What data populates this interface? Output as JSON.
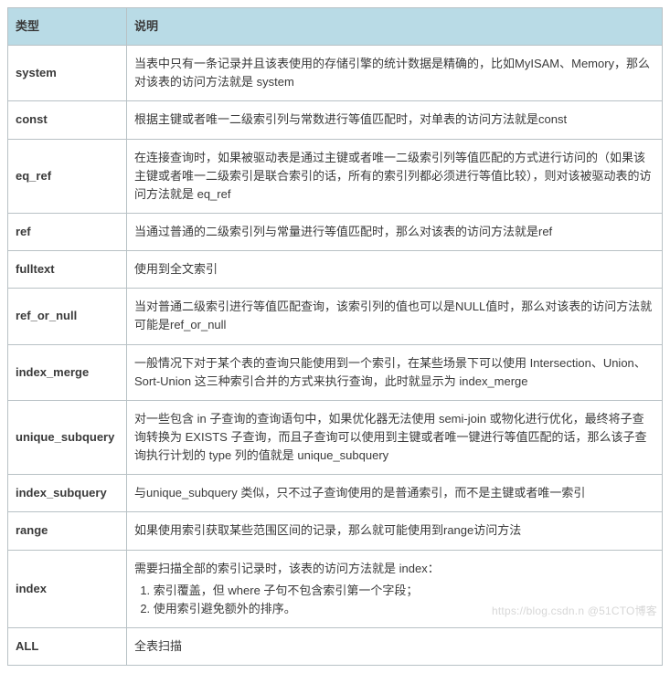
{
  "table": {
    "headers": {
      "type": "类型",
      "desc": "说明"
    },
    "index_row": {
      "type": "index",
      "intro": "需要扫描全部的索引记录时，该表的访问方法就是 index：",
      "items": [
        "索引覆盖，但 where 子句不包含索引第一个字段；",
        "使用索引避免额外的排序。"
      ]
    },
    "rows": [
      {
        "type": "system",
        "desc": "当表中只有一条记录并且该表使用的存储引擎的统计数据是精确的，比如MyISAM、Memory，那么对该表的访问方法就是 system"
      },
      {
        "type": "const",
        "desc": "根据主键或者唯一二级索引列与常数进行等值匹配时，对单表的访问方法就是const"
      },
      {
        "type": "eq_ref",
        "desc": "在连接查询时，如果被驱动表是通过主键或者唯一二级索引列等值匹配的方式进行访问的（如果该主键或者唯一二级索引是联合索引的话，所有的索引列都必须进行等值比较），则对该被驱动表的访问方法就是 eq_ref"
      },
      {
        "type": "ref",
        "desc": "当通过普通的二级索引列与常量进行等值匹配时，那么对该表的访问方法就是ref"
      },
      {
        "type": "fulltext",
        "desc": "使用到全文索引"
      },
      {
        "type": "ref_or_null",
        "desc": "当对普通二级索引进行等值匹配查询，该索引列的值也可以是NULL值时，那么对该表的访问方法就可能是ref_or_null"
      },
      {
        "type": "index_merge",
        "desc": "一般情况下对于某个表的查询只能使用到一个索引，在某些场景下可以使用 Intersection、Union、Sort-Union 这三种索引合并的方式来执行查询，此时就显示为 index_merge"
      },
      {
        "type": "unique_subquery",
        "desc": "对一些包含 in 子查询的查询语句中，如果优化器无法使用 semi-join 或物化进行优化，最终将子查询转换为 EXISTS 子查询，而且子查询可以使用到主键或者唯一键进行等值匹配的话，那么该子查询执行计划的 type 列的值就是 unique_subquery"
      },
      {
        "type": "index_subquery",
        "desc": "与unique_subquery 类似，只不过子查询使用的是普通索引，而不是主键或者唯一索引"
      },
      {
        "type": "range",
        "desc": "如果使用索引获取某些范围区间的记录，那么就可能使用到range访问方法"
      },
      {
        "type": "ALL",
        "desc": "全表扫描"
      }
    ]
  },
  "watermark": "https://blog.csdn.n      @51CTO博客"
}
